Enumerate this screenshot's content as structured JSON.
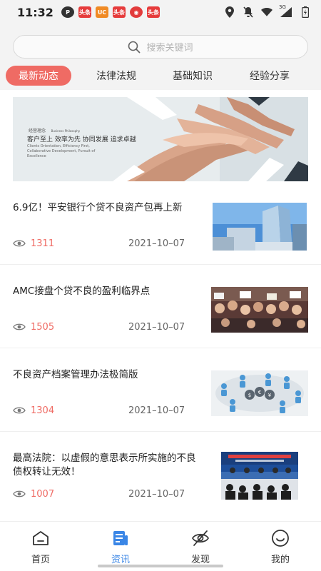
{
  "status_bar": {
    "time": "11:32",
    "apps": [
      {
        "icon": "app-p-icon",
        "color": "#333333",
        "text": "P"
      },
      {
        "icon": "toutiao-icon",
        "color": "#e63b3b",
        "text": "头条"
      },
      {
        "icon": "uc-icon",
        "color": "#f08a24",
        "text": "UC"
      },
      {
        "icon": "toutiao-icon",
        "color": "#e63b3b",
        "text": "头条"
      },
      {
        "icon": "weibo-icon",
        "color": "#e23b3b",
        "text": "◉"
      },
      {
        "icon": "toutiao-icon",
        "color": "#e63b3b",
        "text": "头条"
      }
    ],
    "network": "3G"
  },
  "search": {
    "placeholder": "搜索关键词"
  },
  "tabs": [
    {
      "label": "最新动态",
      "active": true
    },
    {
      "label": "法律法规",
      "active": false
    },
    {
      "label": "基础知识",
      "active": false
    },
    {
      "label": "经验分享",
      "active": false
    }
  ],
  "banner": {
    "heading": "经营理念",
    "heading_en": "Business Philosophy",
    "slogan": "客户至上  效率为先  协同发展  追求卓越",
    "slogan_en": "Clients Orientation, Efficiency First, Collaborative Development, Pursuit of Excellence"
  },
  "articles": [
    {
      "title": "6.9亿！平安银行个贷不良资产包再上新",
      "views": "1311",
      "date": "2021–10–07",
      "thumb": "skyscraper"
    },
    {
      "title": "AMC接盘个贷不良的盈利临界点",
      "views": "1505",
      "date": "2021–10–07",
      "thumb": "crowd"
    },
    {
      "title": "不良资产档案管理办法极简版",
      "views": "1304",
      "date": "2021–10–07",
      "thumb": "network"
    },
    {
      "title": "最高法院：以虚假的意思表示所实施的不良债权转让无效！",
      "views": "1007",
      "date": "2021–10–07",
      "thumb": "pressconf"
    }
  ],
  "bottom_nav": [
    {
      "label": "首页",
      "icon": "home-icon",
      "active": false
    },
    {
      "label": "资讯",
      "icon": "news-icon",
      "active": true
    },
    {
      "label": "发现",
      "icon": "discover-icon",
      "active": false
    },
    {
      "label": "我的",
      "icon": "profile-icon",
      "active": false
    }
  ],
  "colors": {
    "accent": "#ef6b64",
    "nav_active": "#3a86e6"
  }
}
